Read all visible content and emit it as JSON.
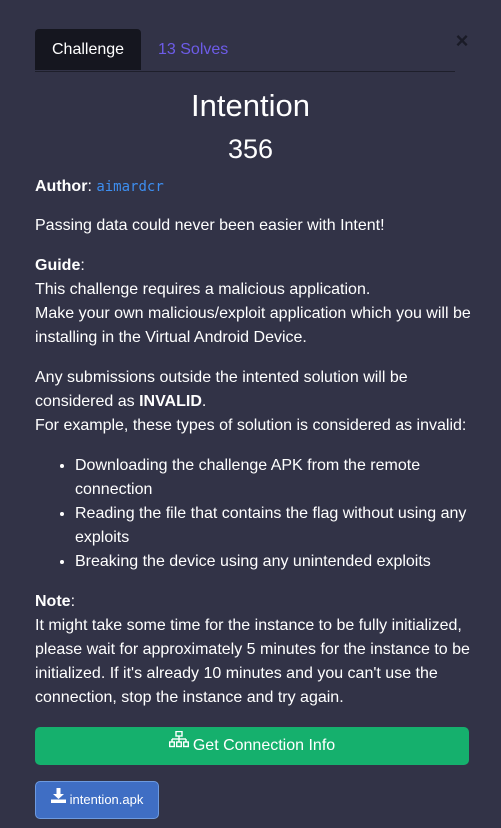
{
  "tabs": {
    "challenge_label": "Challenge",
    "solves_label": "13 Solves"
  },
  "close_glyph": "×",
  "challenge": {
    "title": "Intention",
    "points": "356",
    "author_label": "Author",
    "author_sep": ": ",
    "author_name": "aimardcr",
    "intro": "Passing data could never been easier with Intent!",
    "guide_label": "Guide",
    "guide_sep": ":",
    "guide_line1": "This challenge requires a malicious application.",
    "guide_line2": "Make your own malicious/exploit application which you will be installing in the Virtual Android Device.",
    "rule_line1_prefix": "Any submissions outside the intented solution will be considered as ",
    "rule_invalid": "INVALID",
    "rule_line1_suffix": ".",
    "rule_line2": "For example, these types of solution is considered as invalid:",
    "bullets": [
      "Downloading the challenge APK from the remote connection",
      "Reading the file that contains the flag without using any exploits",
      "Breaking the device using any unintended exploits"
    ],
    "note_label": "Note",
    "note_sep": ":",
    "note_text": "It might take some time for the instance to be fully initialized, please wait for approximately 5 minutes for the instance to be initialized. If it's already 10 minutes and you can't use the connection, stop the instance and try again."
  },
  "buttons": {
    "connect_label": "Get Connection Info",
    "connect_icon": "network-icon",
    "download_label": "intention.apk",
    "download_icon": "download-icon"
  },
  "colors": {
    "modal_bg": "#323347",
    "tab_active_bg": "#15161f",
    "tab_inactive_text": "#6d5ce8",
    "author_link": "#3d8ef0",
    "connect_button": "#15b06d",
    "download_button": "#3f6ec4"
  }
}
